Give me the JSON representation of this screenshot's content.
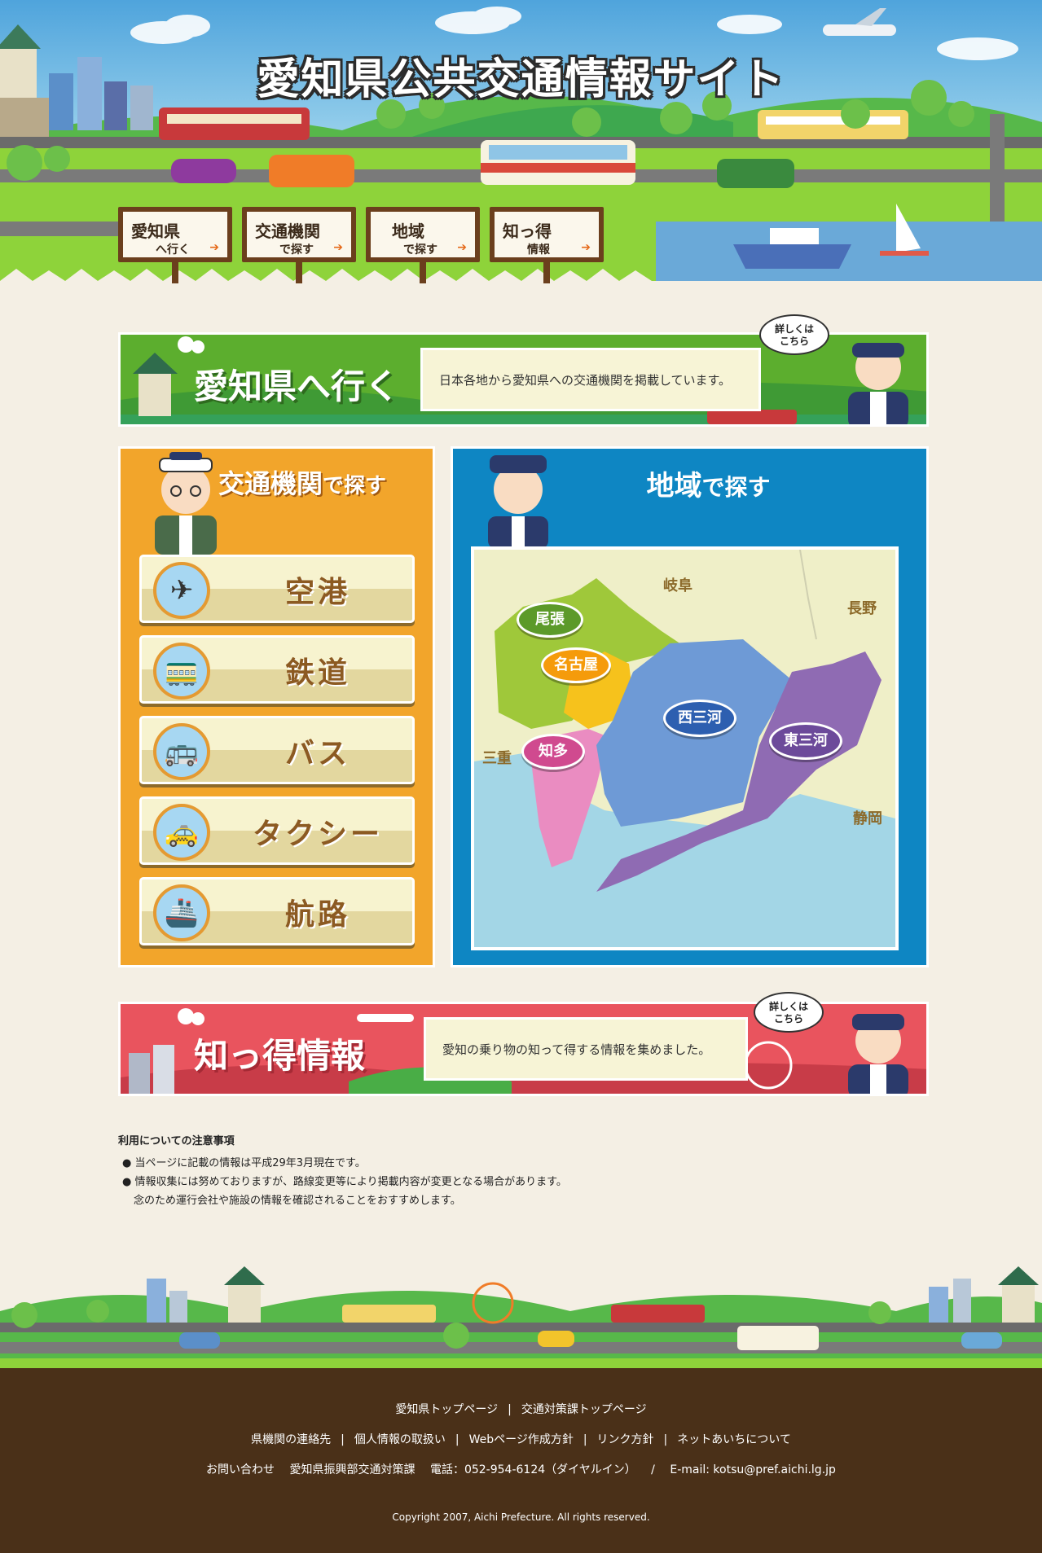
{
  "header": {
    "title": "愛知県公共交通情報サイト",
    "nav": [
      {
        "line1": "愛知県",
        "line2": "へ行く"
      },
      {
        "line1": "交通機関",
        "line2": "で探す"
      },
      {
        "line1": "地域",
        "line2": "で探す"
      },
      {
        "line1": "知っ得",
        "line2": "情報"
      }
    ]
  },
  "visit_banner": {
    "title": "愛知県へ行く",
    "description": "日本各地から愛知県への交通機関を掲載しています。",
    "bubble": "詳しくは\nこちら"
  },
  "transport": {
    "title_main": "交通機関",
    "title_suffix": "で探す",
    "items": [
      {
        "label": "空港",
        "icon": "✈"
      },
      {
        "label": "鉄道",
        "icon": "🚃"
      },
      {
        "label": "バス",
        "icon": "🚌"
      },
      {
        "label": "タクシー",
        "icon": "🚕"
      },
      {
        "label": "航路",
        "icon": "🚢"
      }
    ]
  },
  "region": {
    "title_main": "地域",
    "title_suffix": "で探す",
    "regions": [
      "尾張",
      "名古屋",
      "知多",
      "西三河",
      "東三河"
    ],
    "neighbors": [
      "岐阜",
      "長野",
      "三重",
      "静岡"
    ]
  },
  "info_banner": {
    "title": "知っ得情報",
    "description": "愛知の乗り物の知って得する情報を集めました。",
    "bubble": "詳しくは\nこちら"
  },
  "notes": {
    "heading": "利用についての注意事項",
    "items": [
      "当ページに記載の情報は平成29年3月現在です。",
      "情報収集には努めておりますが、路線変更等により掲載内容が変更となる場合があります。",
      "念のため運行会社や施設の情報を確認されることをおすすめします。"
    ]
  },
  "footer": {
    "row1": [
      "愛知県トップページ",
      "交通対策課トップページ"
    ],
    "row2": [
      "県機関の連絡先",
      "個人情報の取扱い",
      "Webページ作成方針",
      "リンク方針",
      "ネットあいちについて"
    ],
    "contact": {
      "label": "お問い合わせ",
      "dept": "愛知県振興部交通対策課",
      "tel": "電話：052-954-6124（ダイヤルイン）",
      "slash": "/",
      "email": "E-mail: kotsu@pref.aichi.lg.jp"
    },
    "copyright": "Copyright 2007, Aichi Prefecture. All rights reserved."
  },
  "colors": {
    "orange_panel": "#f2a52b",
    "blue_panel": "#0e86c3",
    "green_banner": "#5cae2e",
    "red_banner": "#e9545e",
    "footer_bg": "#4a3018"
  }
}
